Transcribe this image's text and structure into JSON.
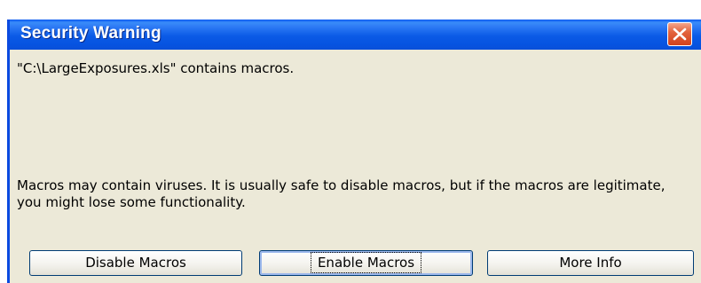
{
  "dialog": {
    "title": "Security Warning",
    "message": "\"C:\\LargeExposures.xls\" contains macros.",
    "warning_text": "Macros may contain viruses. It is usually safe to disable macros, but if the macros are legitimate, you might lose some functionality."
  },
  "buttons": {
    "disable_macros": "Disable Macros",
    "enable_macros": "Enable Macros",
    "more_info": "More Info"
  },
  "icons": {
    "close": "close-icon"
  },
  "colors": {
    "titlebar_blue": "#0b5ae6",
    "dialog_background": "#ece9d8",
    "close_button_red": "#e3643e"
  }
}
